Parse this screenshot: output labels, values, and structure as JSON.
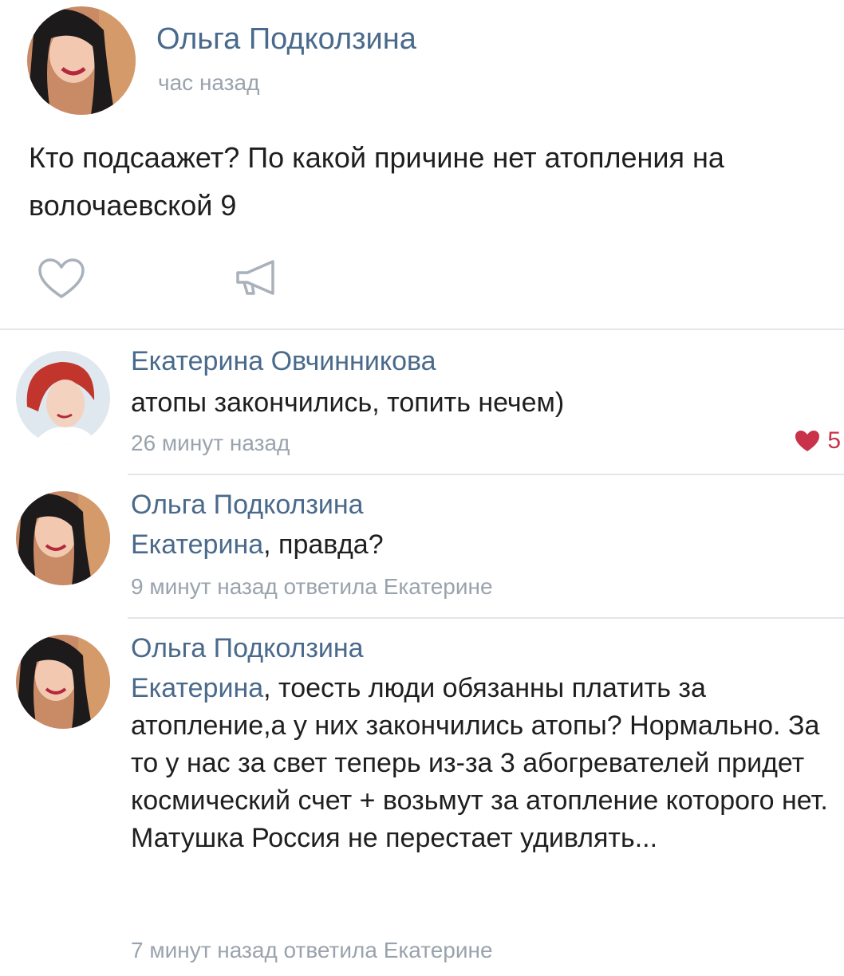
{
  "post": {
    "author": "Ольга Подколзина",
    "time": "час назад",
    "text": "Кто подсаажет? По какой причине нет атопления на волочаевской 9",
    "like_icon": "heart-outline-icon",
    "share_icon": "megaphone-icon"
  },
  "comments": [
    {
      "author": "Екатерина Овчинникова",
      "text": "атопы закончились, топить нечем)",
      "time": "26 минут назад",
      "likes": "5",
      "like_icon": "heart-filled-icon",
      "avatar": "cartoon-redhead-avatar"
    },
    {
      "author": "Ольга Подколзина",
      "mention": "Екатерина",
      "text": ", правда?",
      "time": "9 минут назад ответила Екатерине",
      "avatar": "woman-photo-avatar"
    },
    {
      "author": "Ольга Подколзина",
      "mention": "Екатерина",
      "text": ", тоесть люди обязанны платить за атопление,а у них закончились атопы? Нормально. За то у нас за свет теперь из-за 3 абогревателей придет космический счет + возьмут за атопление которого нет. Матушка Россия не перестает удивлять...",
      "time": "7 минут назад ответила Екатерине",
      "avatar": "woman-photo-avatar"
    }
  ],
  "colors": {
    "link": "#4a6a8c",
    "meta": "#9aa3ad",
    "like": "#c9334a",
    "divider": "#e3e6ea"
  }
}
